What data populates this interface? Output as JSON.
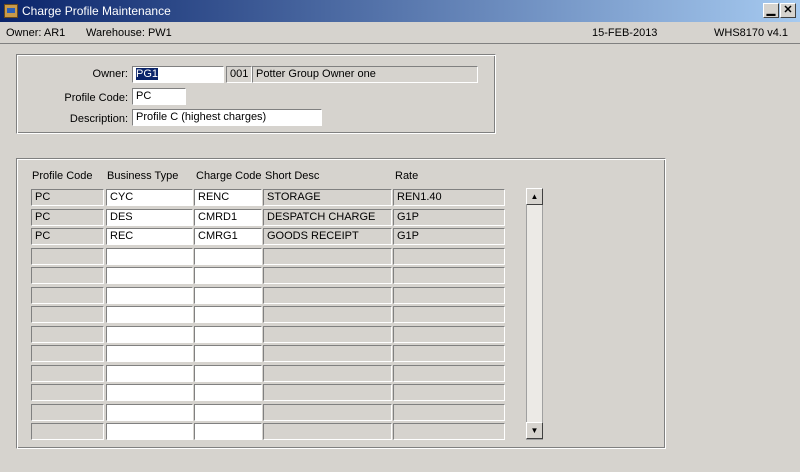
{
  "window": {
    "title": "Charge Profile Maintenance",
    "minimize_label": "▁",
    "close_label": "✕"
  },
  "status": {
    "owner": "Owner:  AR1",
    "warehouse": "Warehouse:  PW1",
    "date": "15-FEB-2013",
    "version": "WHS8170  v4.1"
  },
  "form": {
    "owner_label": "Owner:",
    "owner_value": "PG1",
    "owner_code": "001",
    "owner_name": "Potter Group Owner one",
    "profile_code_label": "Profile Code:",
    "profile_code_value": "PC",
    "description_label": "Description:",
    "description_value": "Profile C (highest charges)"
  },
  "grid": {
    "headers": [
      "Profile Code",
      "Business Type",
      "Charge Code",
      "Short Desc",
      "Rate"
    ],
    "rows": [
      [
        "PC",
        "CYC",
        "RENC",
        "STORAGE",
        "REN1.40"
      ],
      [
        "PC",
        "DES",
        "CMRD1",
        "DESPATCH CHARGE",
        "G1P"
      ],
      [
        "PC",
        "REC",
        "CMRG1",
        "GOODS RECEIPT",
        "G1P"
      ],
      [
        "",
        "",
        "",
        "",
        ""
      ],
      [
        "",
        "",
        "",
        "",
        ""
      ],
      [
        "",
        "",
        "",
        "",
        ""
      ],
      [
        "",
        "",
        "",
        "",
        ""
      ],
      [
        "",
        "",
        "",
        "",
        ""
      ],
      [
        "",
        "",
        "",
        "",
        ""
      ],
      [
        "",
        "",
        "",
        "",
        ""
      ],
      [
        "",
        "",
        "",
        "",
        ""
      ],
      [
        "",
        "",
        "",
        "",
        ""
      ],
      [
        "",
        "",
        "",
        "",
        ""
      ]
    ]
  },
  "scrollbar": {
    "up_icon": "▲",
    "down_icon": "▼"
  }
}
